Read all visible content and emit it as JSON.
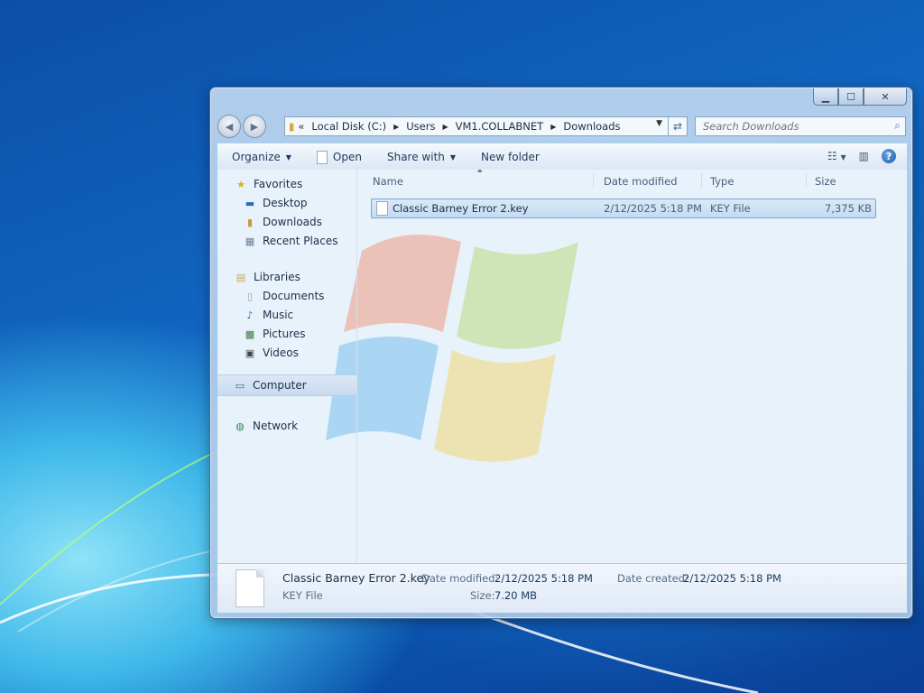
{
  "window": {
    "controls": [
      "minimize",
      "maximize",
      "close"
    ]
  },
  "address_bar": {
    "overflow_marker": "«",
    "crumbs": [
      "Local Disk (C:)",
      "Users",
      "VM1.COLLABNET",
      "Downloads"
    ]
  },
  "search": {
    "placeholder": "Search Downloads"
  },
  "toolbar": {
    "organize": "Organize",
    "open": "Open",
    "share_with": "Share with",
    "new_folder": "New folder"
  },
  "nav_pane": {
    "favorites": "Favorites",
    "desktop": "Desktop",
    "downloads": "Downloads",
    "recent_places": "Recent Places",
    "libraries": "Libraries",
    "documents": "Documents",
    "music": "Music",
    "pictures": "Pictures",
    "videos": "Videos",
    "computer": "Computer",
    "network": "Network"
  },
  "columns": [
    "Name",
    "Date modified",
    "Type",
    "Size"
  ],
  "files": [
    {
      "name": "Classic Barney Error 2.key",
      "date_modified": "2/12/2025 5:18 PM",
      "type": "KEY File",
      "size": "7,375 KB"
    }
  ],
  "details_pane": {
    "file_name": "Classic Barney Error 2.key",
    "file_type": "KEY File",
    "date_modified_label": "Date modified:",
    "date_modified": "2/12/2025 5:18 PM",
    "size_label": "Size:",
    "size": "7.20 MB",
    "date_created_label": "Date created:",
    "date_created": "2/12/2025 5:18 PM"
  },
  "colors": {
    "desktop_blue": "#1165c0",
    "selection_border": "#7da2ce",
    "selection_fill": "#c4dbf3"
  }
}
